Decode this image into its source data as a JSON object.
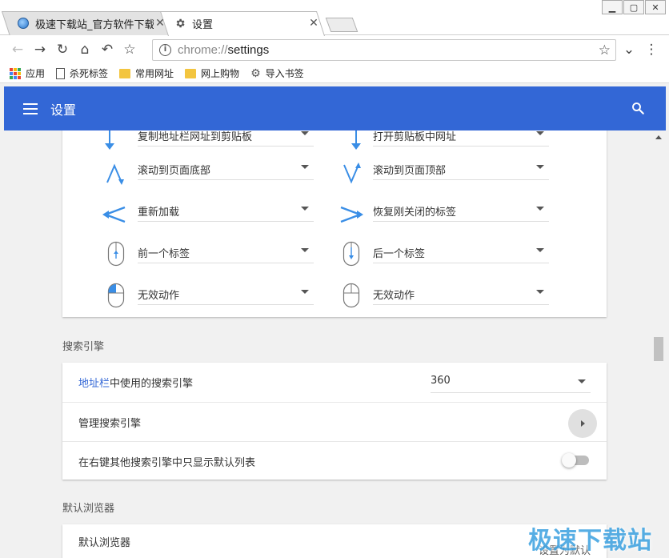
{
  "tabs": [
    {
      "title": "极速下载站_官方软件下载",
      "active": false
    },
    {
      "title": "设置",
      "active": true
    }
  ],
  "window_controls": {
    "minimize": "▭",
    "maximize": "▣",
    "close": "✕"
  },
  "address_bar": {
    "scheme": "chrome://",
    "path": "settings"
  },
  "bookmarks": [
    {
      "label": "应用",
      "icon": "apps-icon"
    },
    {
      "label": "杀死标签",
      "icon": "page-icon"
    },
    {
      "label": "常用网址",
      "icon": "folder-icon"
    },
    {
      "label": "网上购物",
      "icon": "folder-icon"
    },
    {
      "label": "导入书签",
      "icon": "gear-icon"
    }
  ],
  "header": {
    "title": "设置"
  },
  "gestures": {
    "left": [
      {
        "label": "复制地址栏网址到剪贴板",
        "icon": "arrow-down"
      },
      {
        "label": "滚动到页面底部",
        "icon": "up-down"
      },
      {
        "label": "重新加载",
        "icon": "left-angle"
      },
      {
        "label": "前一个标签",
        "icon": "mouse-up"
      },
      {
        "label": "无效动作",
        "icon": "mouse-left"
      }
    ],
    "right": [
      {
        "label": "打开剪贴板中网址",
        "icon": "arrow-down"
      },
      {
        "label": "滚动到页面顶部",
        "icon": "down-up"
      },
      {
        "label": "恢复刚关闭的标签",
        "icon": "right-angle"
      },
      {
        "label": "后一个标签",
        "icon": "mouse-down"
      },
      {
        "label": "无效动作",
        "icon": "mouse-plain"
      }
    ]
  },
  "search_engine": {
    "section_title": "搜索引擎",
    "address_bar_link": "地址栏",
    "address_bar_rest": "中使用的搜索引擎",
    "selected_engine": "360",
    "manage_label": "管理搜索引擎",
    "context_menu_label": "在右键其他搜索引擎中只显示默认列表"
  },
  "default_browser": {
    "section_title": "默认浏览器",
    "row_label": "默认浏览器",
    "button_label": "设置为默认"
  },
  "watermark": "极速下载站",
  "colors": {
    "accent": "#3367d6",
    "gesture_blue": "#3a8ee6"
  }
}
